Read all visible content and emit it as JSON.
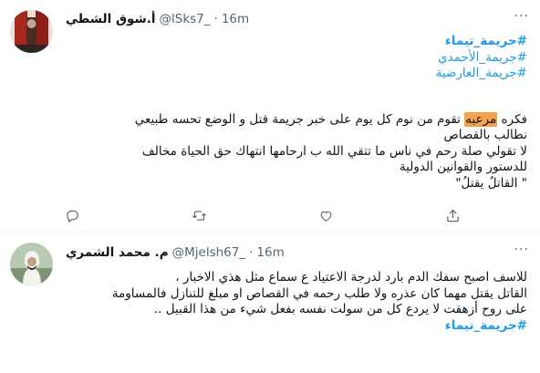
{
  "tweets": [
    {
      "display_name": "أ.شوق الشطي",
      "handle": "@lSks7_",
      "separator": "·",
      "time": "16m",
      "more_label": "···",
      "hashtags": [
        "#جريمة_تيماء",
        "#جريمة_الأحمدي",
        "#جريمة_العارضية"
      ],
      "body": {
        "line1_start": "فكره ",
        "line1_highlight": "مرعبه",
        "line1_end": " تقوم من نوم كل يوم على خبر جريمة قتل و الوضع تحسه طبيعي",
        "line2": "نطالب بالقصاص",
        "line3": "لا تقولي صلة رحم في ناس ما تتقي الله ب ارحامها انتهاك حق الحياة مخالف",
        "line4": "للدستور والقوانين الدولية",
        "line5": "\" القاتلُ يقتلُ\""
      },
      "avatar_colors": {
        "bg": "#e9e0d8",
        "accent": "#a8271f",
        "dark": "#4a2a22"
      }
    },
    {
      "display_name": "م. محمد الشمري",
      "handle": "@Mjelsh67_",
      "separator": "·",
      "time": "16m",
      "more_label": "···",
      "body": {
        "line1": "للاسف اصبح سفك الدم بارد لدرجة الاعتياد ع سماع مثل هذي الاخبار ،",
        "line2": "القاتل يقتل مهما كان عذره ولا طلب رحمه في القصاص او مبلغ للتنازل فالمساومة",
        "line3": "على روح أزهقت لا يردع كل من سولت نفسه بفعل شيء من هذا القبيل ..",
        "hashtag": "#جريمة_تيماء"
      },
      "avatar_colors": {
        "bg": "#b9c9b4",
        "accent": "#f2f2ee",
        "dark": "#5c6e55"
      }
    }
  ],
  "icons": [
    "reply-icon",
    "retweet-icon",
    "like-icon",
    "share-icon"
  ],
  "colors": {
    "link": "#1d9bf0",
    "muted": "#536471",
    "text": "#0f1419",
    "highlight": "#f5a14b"
  }
}
